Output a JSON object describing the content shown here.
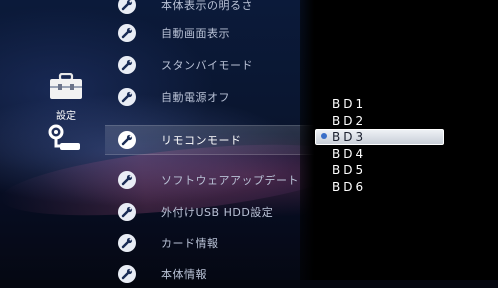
{
  "categories": [
    {
      "label": "設定",
      "icon": "toolbox-icon"
    },
    {
      "label": "",
      "icon": "network-icon"
    }
  ],
  "settings_items": [
    {
      "label": "本体表示の明るさ"
    },
    {
      "label": "自動画面表示"
    },
    {
      "label": "スタンバイモード"
    },
    {
      "label": "自動電源オフ"
    },
    {
      "label": "リモコンモード",
      "selected": true
    },
    {
      "label": "ソフトウェアアップデート"
    },
    {
      "label": "外付けUSB HDD設定"
    },
    {
      "label": "カード情報"
    },
    {
      "label": "本体情報"
    }
  ],
  "options": [
    {
      "label": "BD1"
    },
    {
      "label": "BD2"
    },
    {
      "label": "BD3",
      "selected": true
    },
    {
      "label": "BD4"
    },
    {
      "label": "BD5"
    },
    {
      "label": "BD6"
    }
  ],
  "colors": {
    "accent_dot": "#3a6ec8",
    "selection_bg": "#e6eaf0"
  }
}
